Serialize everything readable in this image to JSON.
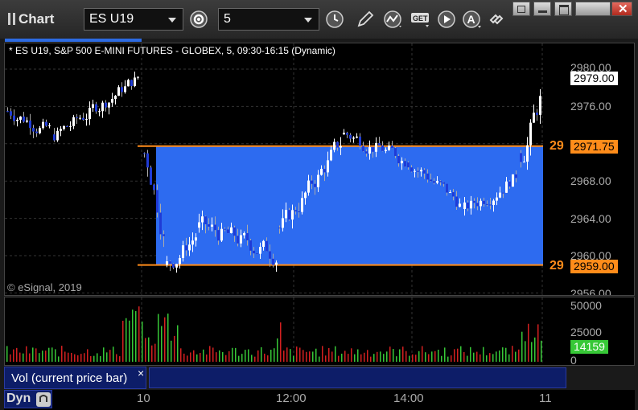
{
  "toolbar": {
    "app_title": "Chart",
    "symbol": "ES U19",
    "interval": "5",
    "icons": [
      "symbol-dropdown-icon",
      "settings-gear-icon",
      "interval-dropdown-icon",
      "clock-icon",
      "pencil-draw-icon",
      "study-wave-icon",
      "get-data-icon",
      "play-icon",
      "a-cursor-icon",
      "link-icon"
    ],
    "window_buttons": [
      "restore-icon",
      "minimize-icon",
      "maximize-icon",
      "close-icon"
    ]
  },
  "chart": {
    "info": "* ES U19, S&P 500 E-MINI FUTURES - GLOBEX, 5, 09:30-16:15 (Dynamic)",
    "copyright": "© eSignal, 2019",
    "price_ticks": [
      "2980.00",
      "2976.00",
      "2968.00",
      "2964.00",
      "2960.00",
      "2956.00"
    ],
    "last_price": "2979.00",
    "upper_level": {
      "tag": "29",
      "price": "2971.75"
    },
    "lower_level": {
      "tag": "29",
      "price": "2959.00"
    },
    "colors": {
      "up": "#ffffff",
      "down": "#1f3bd6",
      "zone": "#2d6bf0",
      "level": "#ff8c1a"
    }
  },
  "volume": {
    "label": "Vol (current price bar)",
    "close_label": "×",
    "ticks": [
      "50000",
      "25000",
      "0"
    ],
    "last_value": "14159",
    "colors": {
      "up": "#37c837",
      "down": "#d42020"
    }
  },
  "time_axis": {
    "dyn_label": "Dyn",
    "labels": [
      "10",
      "12:00",
      "14:00",
      "11"
    ]
  }
}
